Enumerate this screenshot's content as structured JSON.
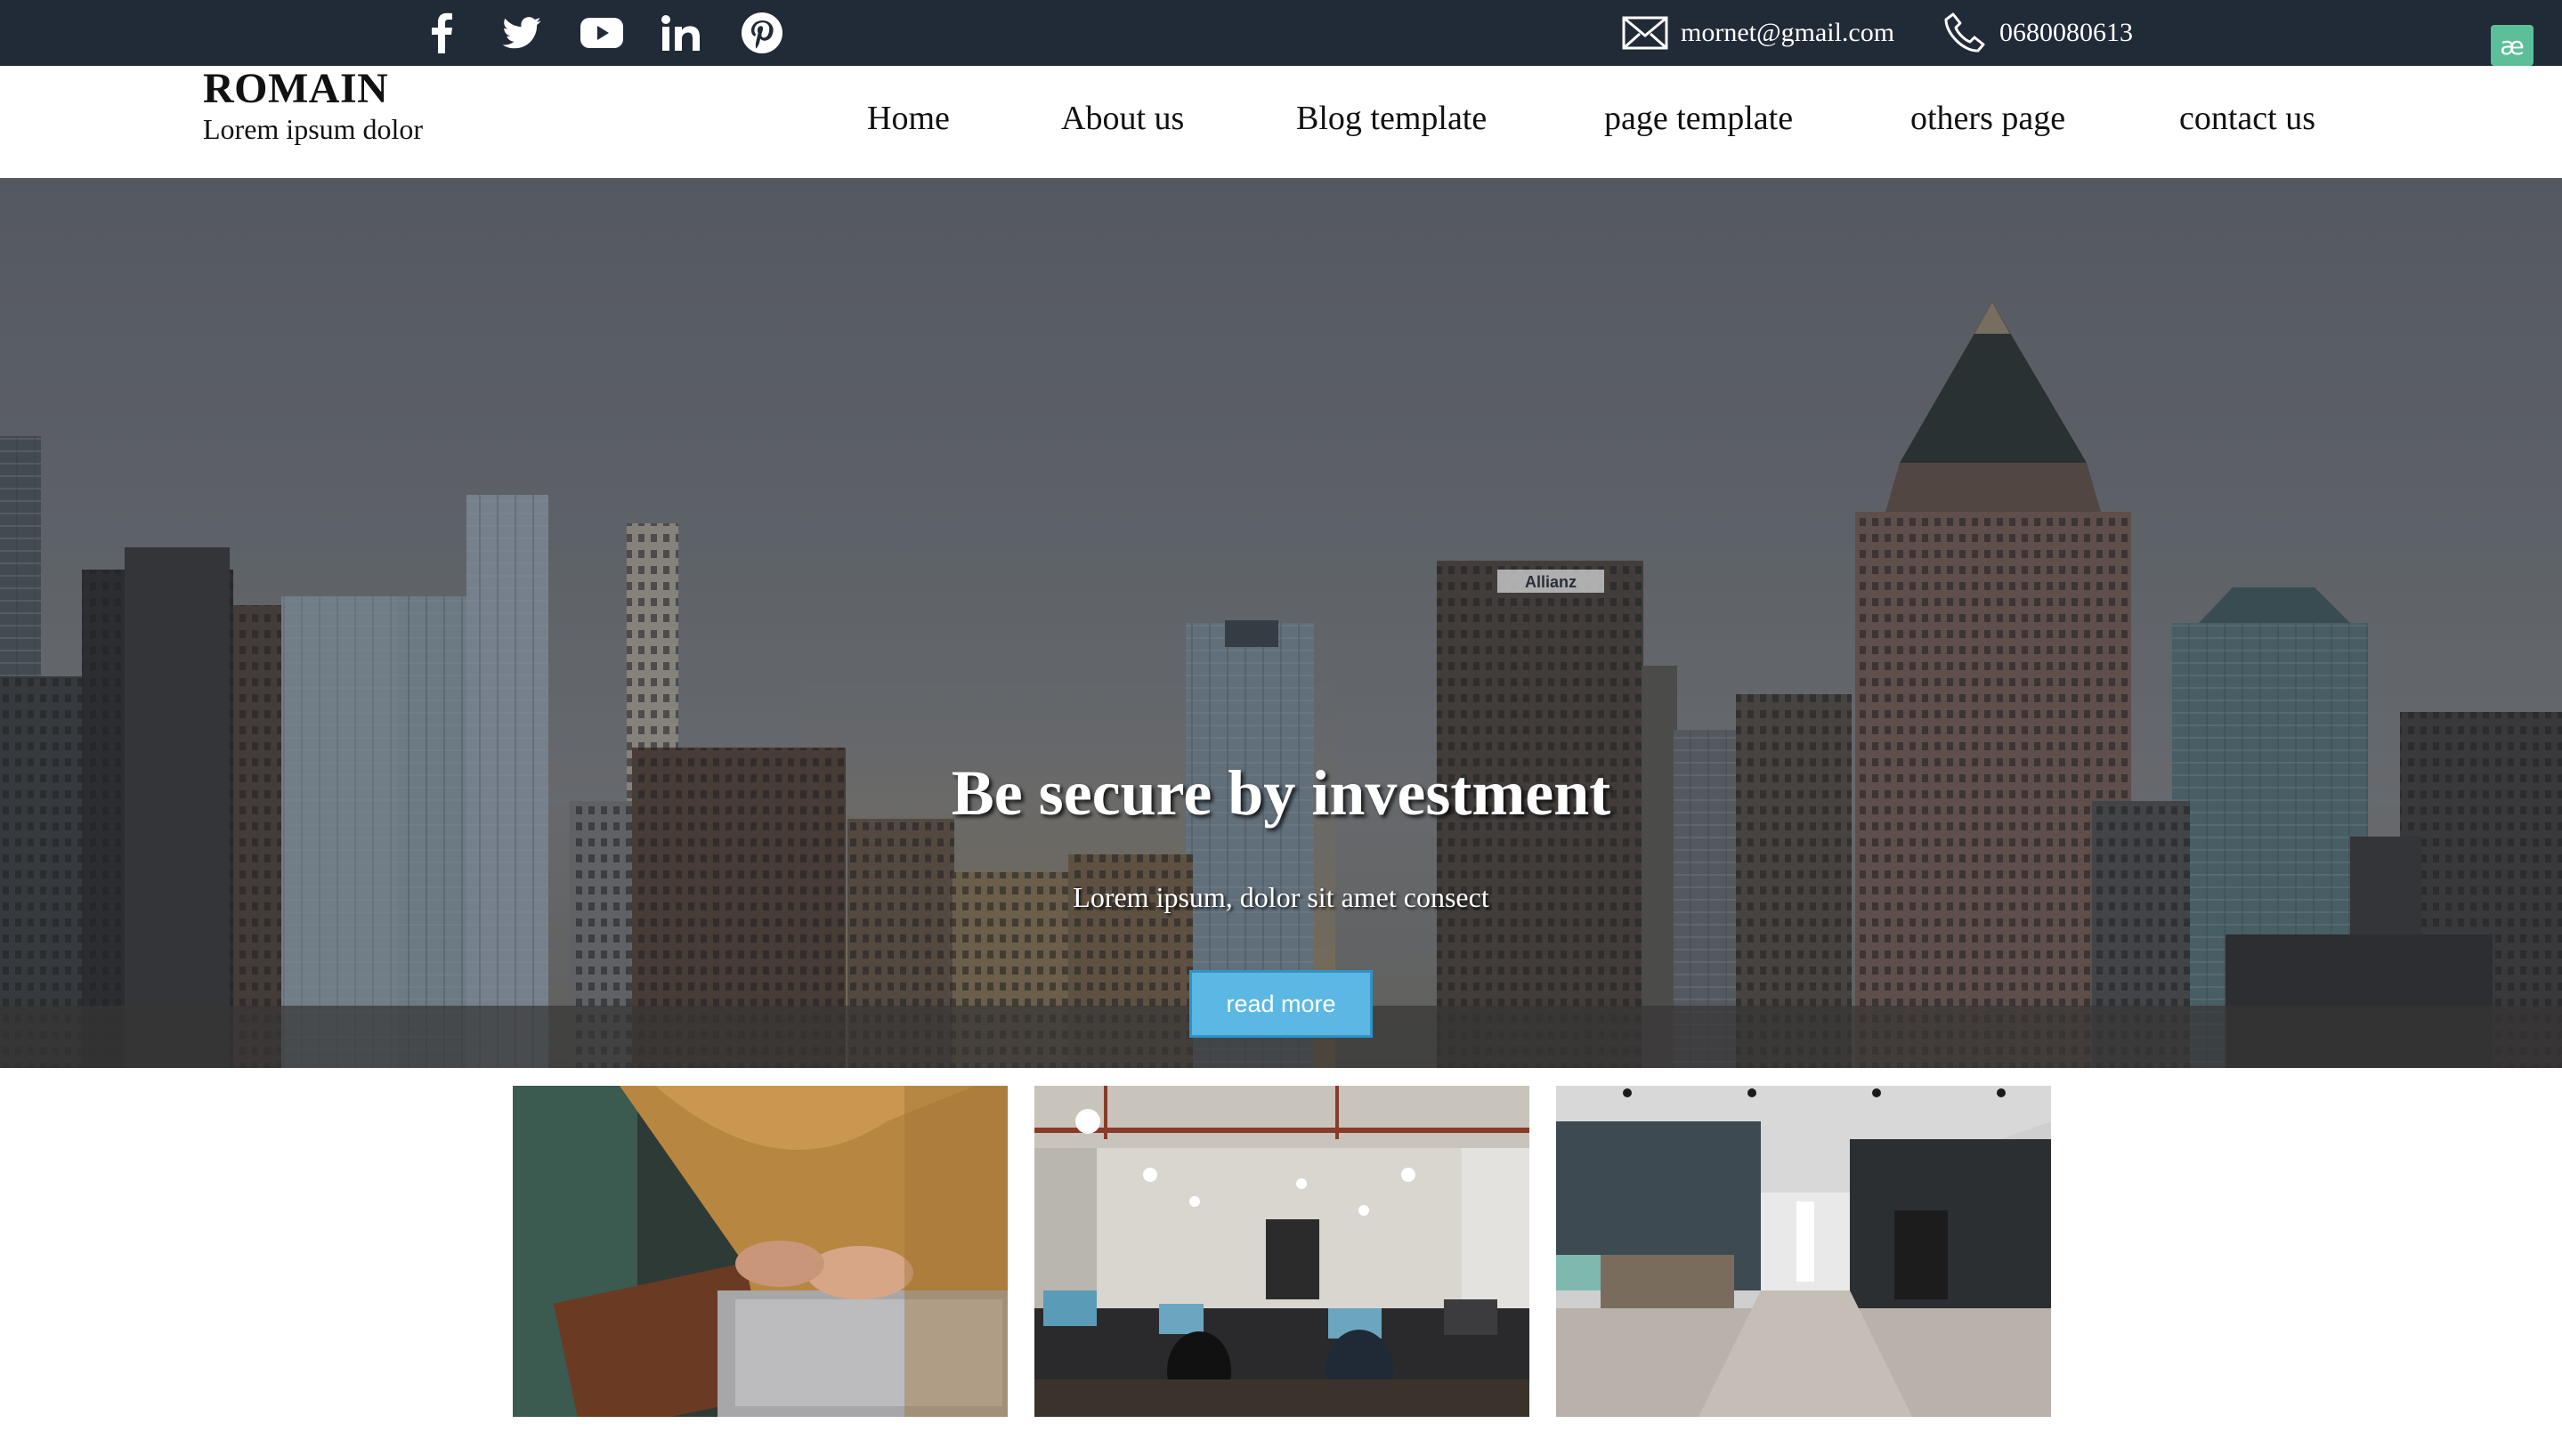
{
  "topbar": {
    "social": [
      {
        "icon": "facebook-icon"
      },
      {
        "icon": "twitter-icon"
      },
      {
        "icon": "youtube-icon"
      },
      {
        "icon": "linkedin-icon"
      },
      {
        "icon": "pinterest-icon"
      }
    ],
    "email": "mornet@gmail.com",
    "phone": "0680080613",
    "extension_badge": "æ"
  },
  "header": {
    "brand_name": "ROMAIN",
    "brand_tagline": "Lorem ipsum dolor",
    "nav": [
      "Home",
      "About us",
      "Blog template",
      "page template",
      "others page",
      "contact us"
    ]
  },
  "hero": {
    "title": "Be secure by investment",
    "subtitle": "Lorem ipsum, dolor sit amet consect",
    "button_label": "read more",
    "building_sign": "Allianz"
  },
  "gallery": {
    "cards": [
      {
        "subject": "person-typing-on-laptop"
      },
      {
        "subject": "open-office-workspace"
      },
      {
        "subject": "empty-office-corridor"
      }
    ]
  },
  "colors": {
    "topbar_bg": "#212a37",
    "button_bg": "#5bb8e4",
    "button_border": "#2f93c7",
    "text_dark": "#111111",
    "badge_bg": "#5dbf9a"
  }
}
